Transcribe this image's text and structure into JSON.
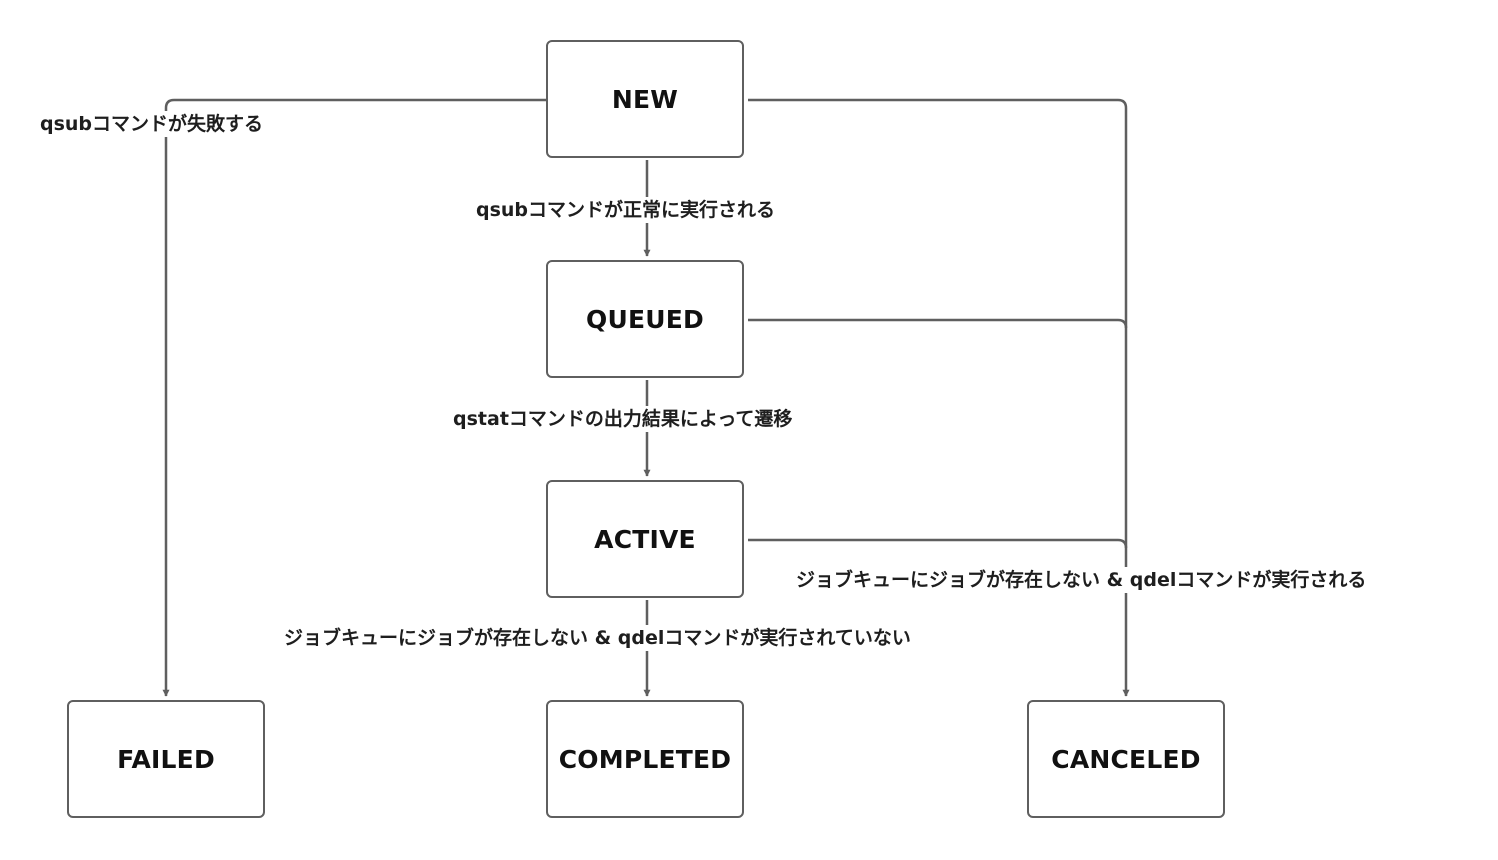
{
  "states": {
    "new": "NEW",
    "queued": "QUEUED",
    "active": "ACTIVE",
    "failed": "FAILED",
    "completed": "COMPLETED",
    "canceled": "CANCELED"
  },
  "transitions": {
    "new_to_failed": "qsubコマンドが失敗する",
    "new_to_queued": "qsubコマンドが正常に実行される",
    "queued_to_active": "qstatコマンドの出力結果によって遷移",
    "active_to_completed": "ジョブキューにジョブが存在しない & qdelコマンドが実行されていない",
    "to_canceled": "ジョブキューにジョブが存在しない & qdelコマンドが実行される"
  },
  "colors": {
    "line": "#5f5f5f",
    "node_border": "#5f5f5f",
    "text": "#111111",
    "background": "#ffffff"
  }
}
